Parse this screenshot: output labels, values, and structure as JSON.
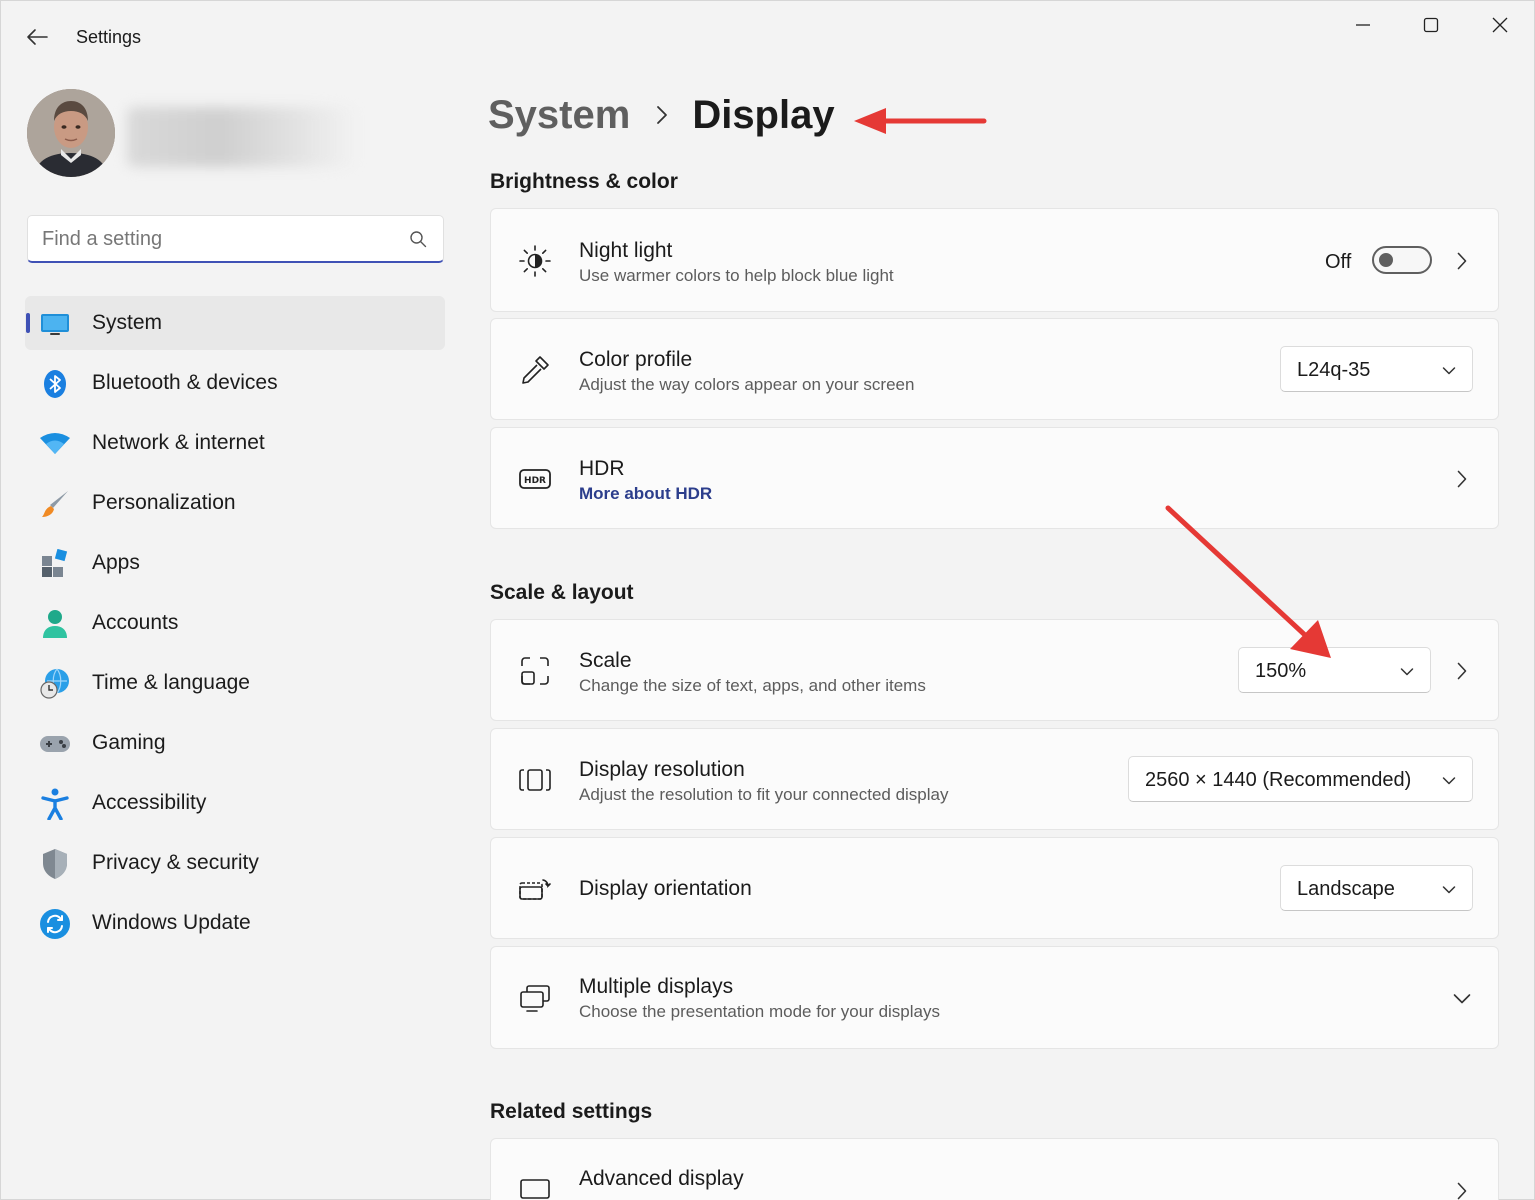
{
  "window": {
    "title": "Settings",
    "controls": {
      "minimize": "minimize-icon",
      "maximize": "maximize-icon",
      "close": "close-icon"
    }
  },
  "search": {
    "placeholder": "Find a setting"
  },
  "sidebar": {
    "items": [
      {
        "label": "System",
        "icon": "system-icon",
        "active": true
      },
      {
        "label": "Bluetooth & devices",
        "icon": "bluetooth-icon"
      },
      {
        "label": "Network & internet",
        "icon": "wifi-icon"
      },
      {
        "label": "Personalization",
        "icon": "brush-icon"
      },
      {
        "label": "Apps",
        "icon": "apps-icon"
      },
      {
        "label": "Accounts",
        "icon": "accounts-icon"
      },
      {
        "label": "Time & language",
        "icon": "globe-clock-icon"
      },
      {
        "label": "Gaming",
        "icon": "gamepad-icon"
      },
      {
        "label": "Accessibility",
        "icon": "accessibility-icon"
      },
      {
        "label": "Privacy & security",
        "icon": "shield-icon"
      },
      {
        "label": "Windows Update",
        "icon": "update-icon"
      }
    ]
  },
  "breadcrumb": {
    "parent": "System",
    "current": "Display"
  },
  "sections": {
    "brightness": "Brightness & color",
    "scale": "Scale & layout",
    "related": "Related settings"
  },
  "cards": {
    "night_light": {
      "title": "Night light",
      "subtitle": "Use warmer colors to help block blue light",
      "state": "Off"
    },
    "color_profile": {
      "title": "Color profile",
      "subtitle": "Adjust the way colors appear on your screen",
      "value": "L24q-35"
    },
    "hdr": {
      "title": "HDR",
      "link": "More about HDR"
    },
    "scale": {
      "title": "Scale",
      "subtitle": "Change the size of text, apps, and other items",
      "value": "150%"
    },
    "resolution": {
      "title": "Display resolution",
      "subtitle": "Adjust the resolution to fit your connected display",
      "value": "2560 × 1440 (Recommended)"
    },
    "orientation": {
      "title": "Display orientation",
      "value": "Landscape"
    },
    "multiple": {
      "title": "Multiple displays",
      "subtitle": "Choose the presentation mode for your displays"
    },
    "advanced": {
      "title": "Advanced display"
    }
  },
  "colors": {
    "accent": "#3f51b5",
    "link": "#2c3e8c",
    "annotation_arrow": "#e53935"
  }
}
